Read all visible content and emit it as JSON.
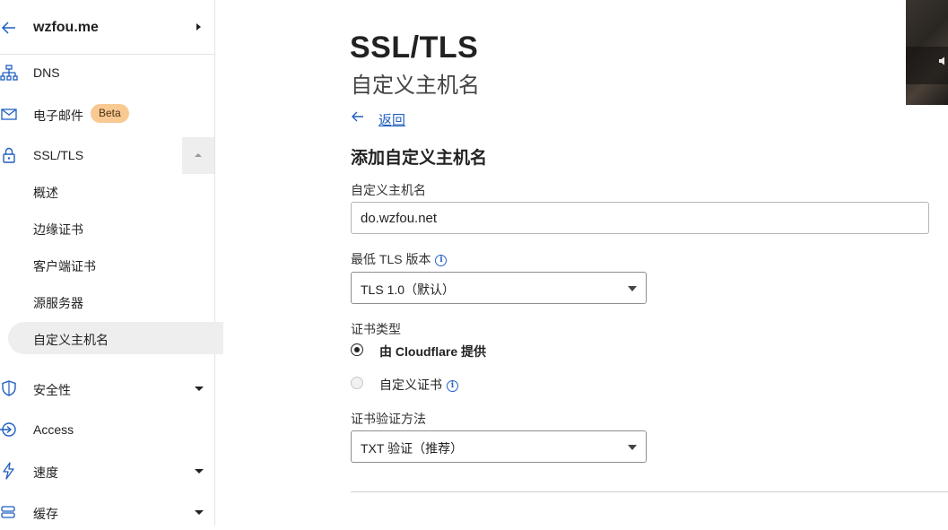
{
  "sidebar": {
    "domain": "wzfou.me",
    "items": [
      {
        "label": "DNS",
        "icon": "sitemap-icon"
      },
      {
        "label": "电子邮件",
        "icon": "envelope-icon",
        "badge": "Beta"
      },
      {
        "label": "SSL/TLS",
        "icon": "lock-icon",
        "expanded": true
      },
      {
        "label": "安全性",
        "icon": "shield-icon"
      },
      {
        "label": "Access",
        "icon": "access-icon"
      },
      {
        "label": "速度",
        "icon": "bolt-icon"
      },
      {
        "label": "缓存",
        "icon": "cache-icon"
      }
    ],
    "ssl_sub": [
      "概述",
      "边缘证书",
      "客户端证书",
      "源服务器",
      "自定义主机名"
    ],
    "active_sub": "自定义主机名"
  },
  "main": {
    "title": "SSL/TLS",
    "subtitle": "自定义主机名",
    "back": "返回",
    "section_title": "添加自定义主机名",
    "hostname": {
      "label": "自定义主机名",
      "value": "do.wzfou.net"
    },
    "min_tls": {
      "label": "最低 TLS 版本",
      "value": "TLS 1.0（默认）"
    },
    "cert_type": {
      "label": "证书类型",
      "options": [
        {
          "label": "由 Cloudflare 提供",
          "selected": true
        },
        {
          "label": "自定义证书",
          "selected": false
        }
      ]
    },
    "validation": {
      "label": "证书验证方法",
      "value": "TXT 验证（推荐）"
    }
  },
  "colors": {
    "link": "#1f5fbf",
    "badge_bg": "#f9c992",
    "active_bg": "#eeeeee"
  }
}
